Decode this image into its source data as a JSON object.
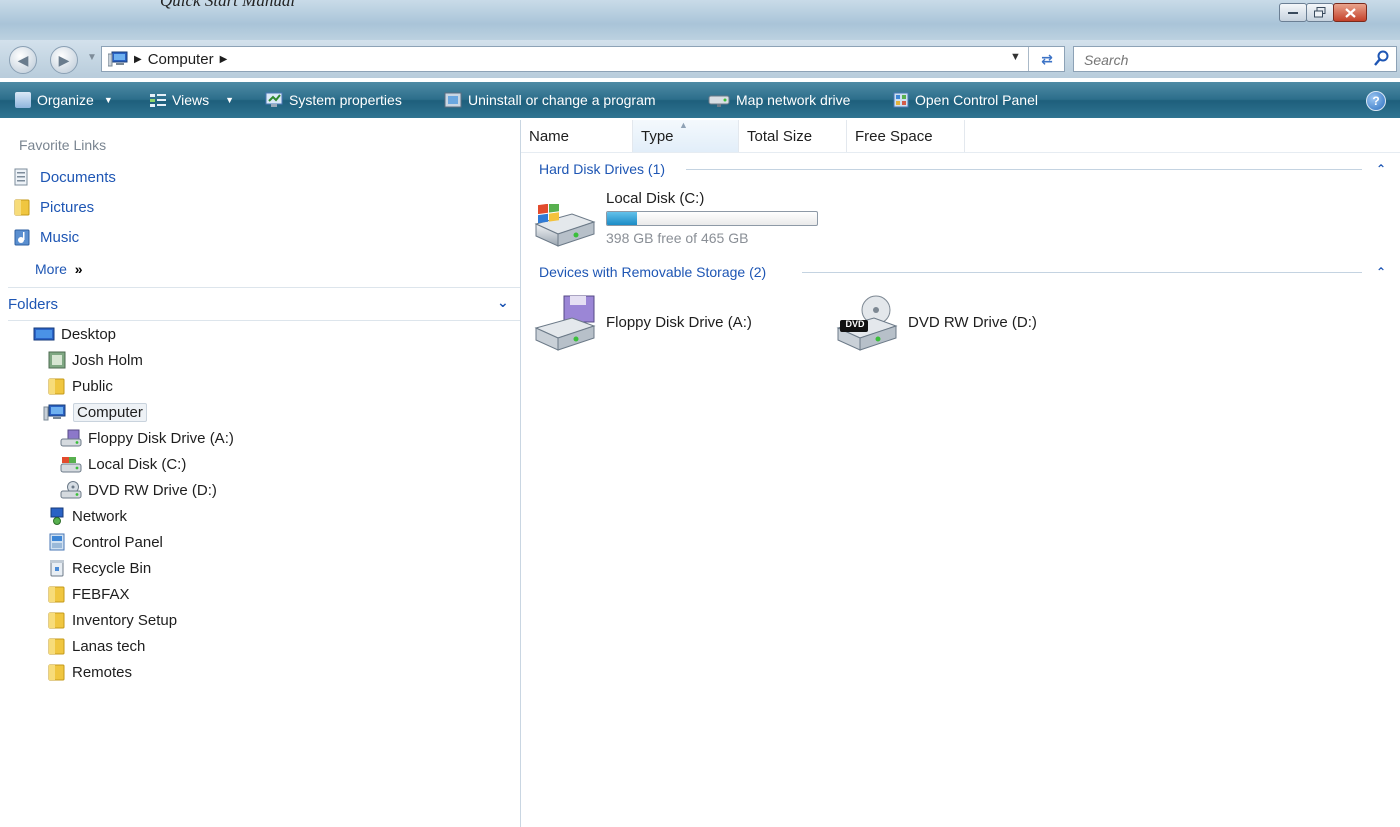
{
  "window": {
    "title": "Quick Start Manual"
  },
  "address_bar": {
    "crumbs": [
      "Computer"
    ],
    "search_placeholder": "Search"
  },
  "toolbar": {
    "organize": "Organize",
    "views": "Views",
    "system_properties": "System properties",
    "uninstall": "Uninstall or change a program",
    "map_drive": "Map network drive",
    "control_panel": "Open Control Panel"
  },
  "sidebar": {
    "favorites_title": "Favorite Links",
    "favorites": [
      "Documents",
      "Pictures",
      "Music"
    ],
    "more": "More",
    "folders_title": "Folders",
    "tree": [
      "Desktop",
      "Josh Holm",
      "Public",
      "Computer",
      "Floppy Disk Drive (A:)",
      "Local Disk (C:)",
      "DVD RW Drive (D:)",
      "Network",
      "Control Panel",
      "Recycle Bin",
      "FEBFAX",
      "Inventory Setup",
      "Lanas tech",
      "Remotes"
    ]
  },
  "columns": [
    "Name",
    "Type",
    "Total Size",
    "Free Space"
  ],
  "groups": {
    "hdd_title": "Hard Disk Drives (1)",
    "removable_title": "Devices with Removable Storage (2)"
  },
  "drives": {
    "c_name": "Local Disk (C:)",
    "c_free_text": "398 GB free of 465 GB",
    "c_used_fraction": 0.144,
    "a_name": "Floppy Disk Drive (A:)",
    "d_name": "DVD RW Drive (D:)",
    "dvd_badge": "DVD"
  }
}
